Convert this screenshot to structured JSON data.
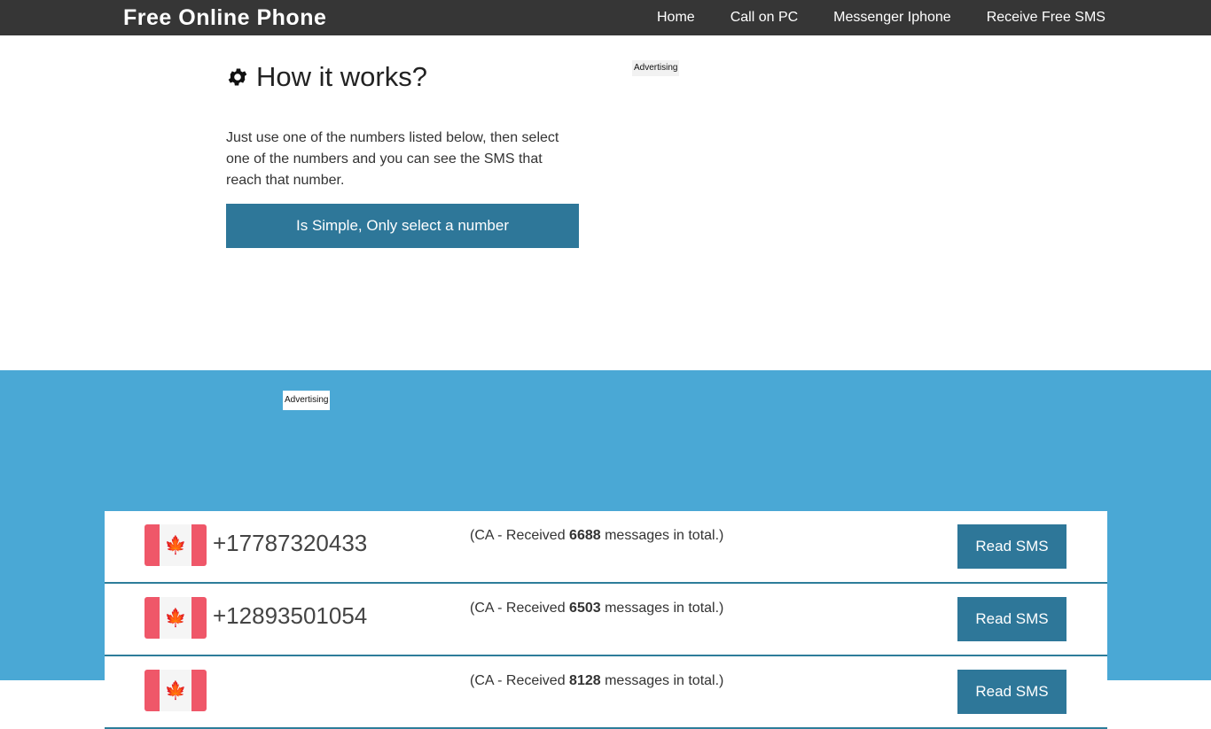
{
  "header": {
    "brand": "Free Online Phone",
    "nav": [
      {
        "label": "Home"
      },
      {
        "label": "Call on PC"
      },
      {
        "label": "Messenger Iphone"
      },
      {
        "label": "Receive Free SMS"
      }
    ]
  },
  "how": {
    "title": "How it works?",
    "icon": "gear-icon",
    "text": "Just use one of the numbers listed below, then select one of the numbers and you can see the SMS that reach that number.",
    "button": "Is Simple, Only select a number"
  },
  "ads": {
    "top_label": "Advertising",
    "blue_label": "Advertising"
  },
  "colors": {
    "header_bg": "#363636",
    "accent": "#2e7799",
    "section_bg": "#4aa8d5",
    "flag_red": "#ef5769"
  },
  "numbers": [
    {
      "country": "CA",
      "number": "+17787320433",
      "prefix": "(CA - Received ",
      "count": "6688",
      "suffix": " messages in total.)",
      "button": "Read SMS"
    },
    {
      "country": "CA",
      "number": "+12893501054",
      "prefix": "(CA - Received ",
      "count": "6503",
      "suffix": " messages in total.)",
      "button": "Read SMS"
    },
    {
      "country": "CA",
      "number": "",
      "prefix": "(CA - Received ",
      "count": "8128",
      "suffix": " messages in total.)",
      "button": "Read SMS"
    }
  ]
}
